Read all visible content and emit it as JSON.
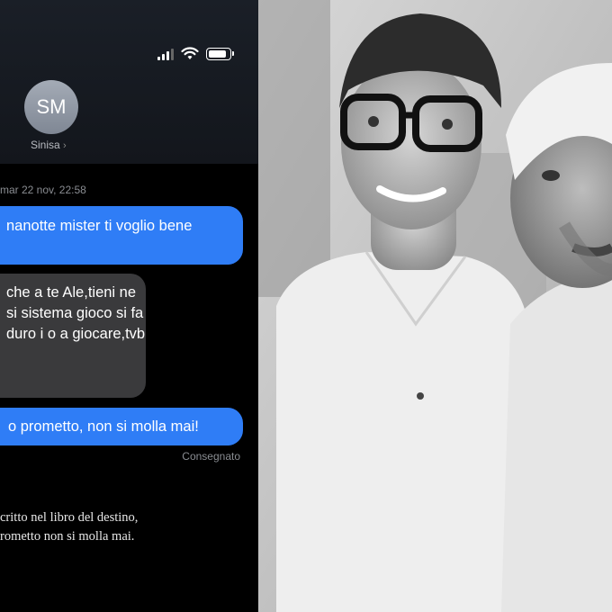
{
  "chat": {
    "contact_initials": "SM",
    "contact_name": "Sinisa",
    "timestamp": "mar 22 nov, 22:58",
    "messages": [
      {
        "direction": "outgoing",
        "text": "nanotte mister ti voglio bene"
      },
      {
        "direction": "incoming",
        "text": "che a te Ale,tieni ne si sistema gioco si fa duro i o a giocare,tvb"
      },
      {
        "direction": "outgoing",
        "text": "o prometto, non si molla mai!"
      }
    ],
    "delivered_label": "Consegnato"
  },
  "caption": {
    "line1": "critto nel libro del destino,",
    "line2": "rometto non si molla mai."
  },
  "colors": {
    "outgoing_bubble": "#2f7df6",
    "incoming_bubble": "#3a3a3c",
    "background": "#000000"
  },
  "icons": [
    "cellular-signal-icon",
    "wifi-icon",
    "battery-icon"
  ],
  "status": {
    "battery_level": 0.85
  }
}
